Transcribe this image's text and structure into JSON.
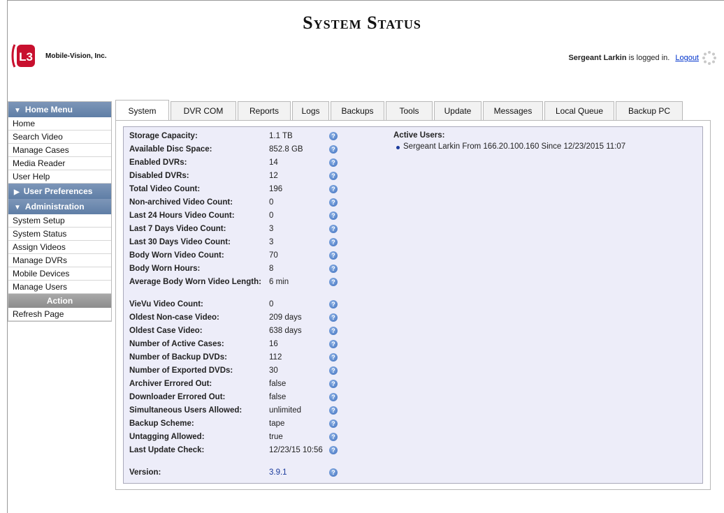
{
  "page_title": "System Status",
  "logo": {
    "badge_text": "L3",
    "company": "Mobile-Vision, Inc."
  },
  "userbar": {
    "user": "Sergeant Larkin",
    "suffix": " is logged in.",
    "logout": "Logout"
  },
  "sidebar": {
    "home_menu": {
      "label": "Home Menu",
      "items": [
        "Home",
        "Search Video",
        "Manage Cases",
        "Media Reader",
        "User Help"
      ]
    },
    "user_prefs": {
      "label": "User Preferences"
    },
    "administration": {
      "label": "Administration",
      "items": [
        "System Setup",
        "System Status",
        "Assign Videos",
        "Manage DVRs",
        "Mobile Devices",
        "Manage Users"
      ]
    },
    "action": {
      "label": "Action",
      "items": [
        "Refresh Page"
      ]
    }
  },
  "tabs": [
    "System",
    "DVR COM",
    "Reports",
    "Logs",
    "Backups",
    "Tools",
    "Update",
    "Messages",
    "Local Queue",
    "Backup PC"
  ],
  "active_tab": "System",
  "stats": [
    {
      "label": "Storage Capacity:",
      "value": "1.1 TB"
    },
    {
      "label": "Available Disc Space:",
      "value": "852.8 GB"
    },
    {
      "label": "Enabled DVRs:",
      "value": "14"
    },
    {
      "label": "Disabled DVRs:",
      "value": "12"
    },
    {
      "label": "Total Video Count:",
      "value": "196"
    },
    {
      "label": "Non-archived Video Count:",
      "value": "0"
    },
    {
      "label": "Last 24 Hours Video Count:",
      "value": "0"
    },
    {
      "label": "Last 7 Days Video Count:",
      "value": "3"
    },
    {
      "label": "Last 30 Days Video Count:",
      "value": "3"
    },
    {
      "label": "Body Worn Video Count:",
      "value": "70"
    },
    {
      "label": "Body Worn Hours:",
      "value": "8"
    },
    {
      "label": "Average Body Worn Video Length:",
      "value": "6 min"
    },
    {
      "label": "VieVu Video Count:",
      "value": "0"
    },
    {
      "label": "Oldest Non-case Video:",
      "value": "209 days"
    },
    {
      "label": "Oldest Case Video:",
      "value": "638 days"
    },
    {
      "label": "Number of Active Cases:",
      "value": "16"
    },
    {
      "label": "Number of Backup DVDs:",
      "value": "112"
    },
    {
      "label": "Number of Exported DVDs:",
      "value": "30"
    },
    {
      "label": "Archiver Errored Out:",
      "value": "false"
    },
    {
      "label": "Downloader Errored Out:",
      "value": "false"
    },
    {
      "label": "Simultaneous Users Allowed:",
      "value": "unlimited"
    },
    {
      "label": "Backup Scheme:",
      "value": "tape"
    },
    {
      "label": "Untagging Allowed:",
      "value": "true"
    },
    {
      "label": "Last Update Check:",
      "value": "12/23/15 10:56"
    },
    {
      "label": "Version:",
      "value": "3.9.1"
    }
  ],
  "active_users": {
    "title": "Active Users:",
    "items": [
      "Sergeant Larkin From 166.20.100.160 Since 12/23/2015 11:07"
    ]
  },
  "help_glyph": "?",
  "icons": {
    "help": "help-circle-icon",
    "expand": "triangle-right-icon",
    "collapse": "triangle-down-icon",
    "loading": "spinner-icon"
  }
}
